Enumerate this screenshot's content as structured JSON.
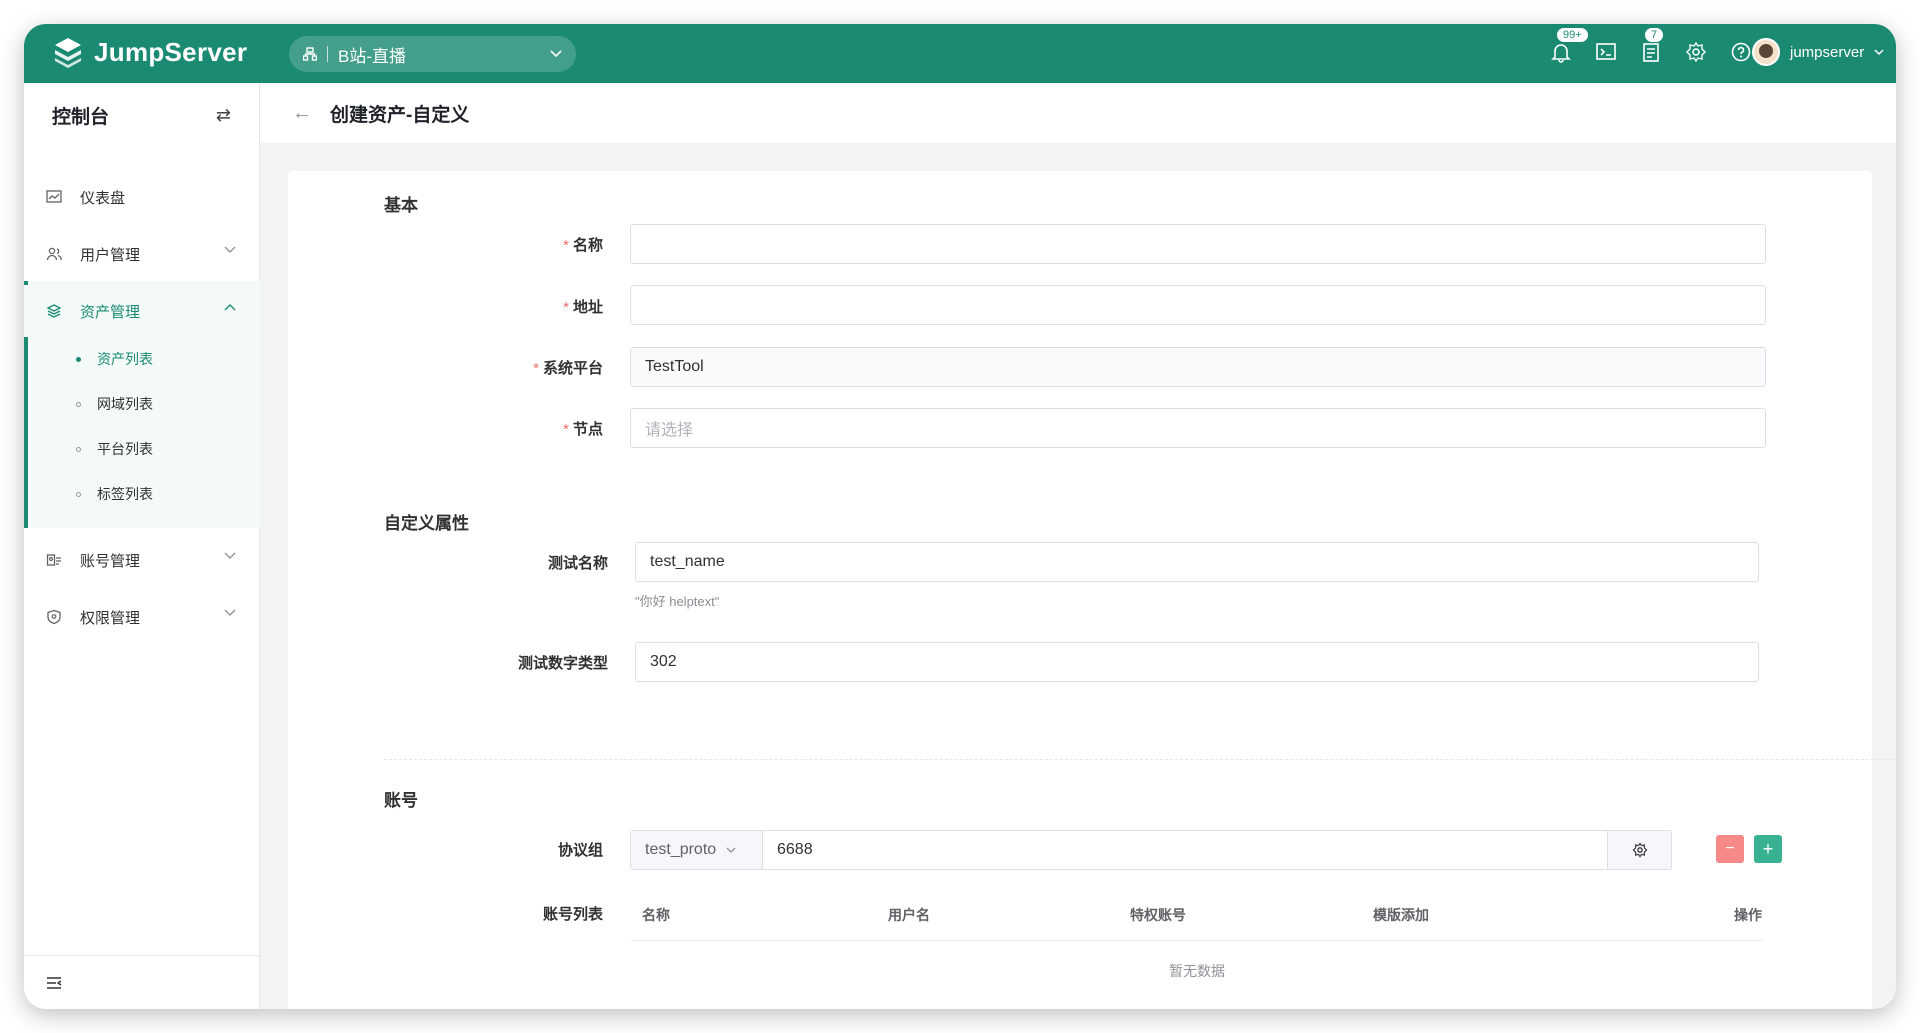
{
  "topbar": {
    "brand": "JumpServer",
    "org": "B站-直播",
    "notif_badge": "99+",
    "tasks_badge": "7",
    "username": "jumpserver",
    "accent": "#1a8a73"
  },
  "sidebar": {
    "title": "控制台",
    "items": [
      {
        "label": "仪表盘",
        "icon": "dashboard-icon"
      },
      {
        "label": "用户管理",
        "icon": "users-icon"
      },
      {
        "label": "资产管理",
        "icon": "assets-icon"
      },
      {
        "label": "账号管理",
        "icon": "accounts-icon"
      },
      {
        "label": "权限管理",
        "icon": "shield-icon"
      }
    ],
    "sub_items": [
      "资产列表",
      "网域列表",
      "平台列表",
      "标签列表"
    ]
  },
  "page": {
    "title": "创建资产-自定义"
  },
  "form": {
    "basic": {
      "title": "基本",
      "name_label": "名称",
      "name_value": "",
      "address_label": "地址",
      "address_value": "",
      "platform_label": "系统平台",
      "platform_value": "TestTool",
      "node_label": "节点",
      "node_placeholder": "请选择"
    },
    "custom": {
      "title": "自定义属性",
      "test_name_label": "测试名称",
      "test_name_value": "test_name",
      "test_name_help": "\"你好 helptext\"",
      "test_number_label": "测试数字类型",
      "test_number_value": "302"
    },
    "account": {
      "title": "账号",
      "protocol_label": "协议组",
      "protocol_name": "test_proto",
      "protocol_port": "6688",
      "accounts_label": "账号列表",
      "table_headers": [
        "名称",
        "用户名",
        "特权账号",
        "模版添加",
        "操作"
      ],
      "empty_text": "暂无数据",
      "minus": "−",
      "plus": "+"
    }
  }
}
